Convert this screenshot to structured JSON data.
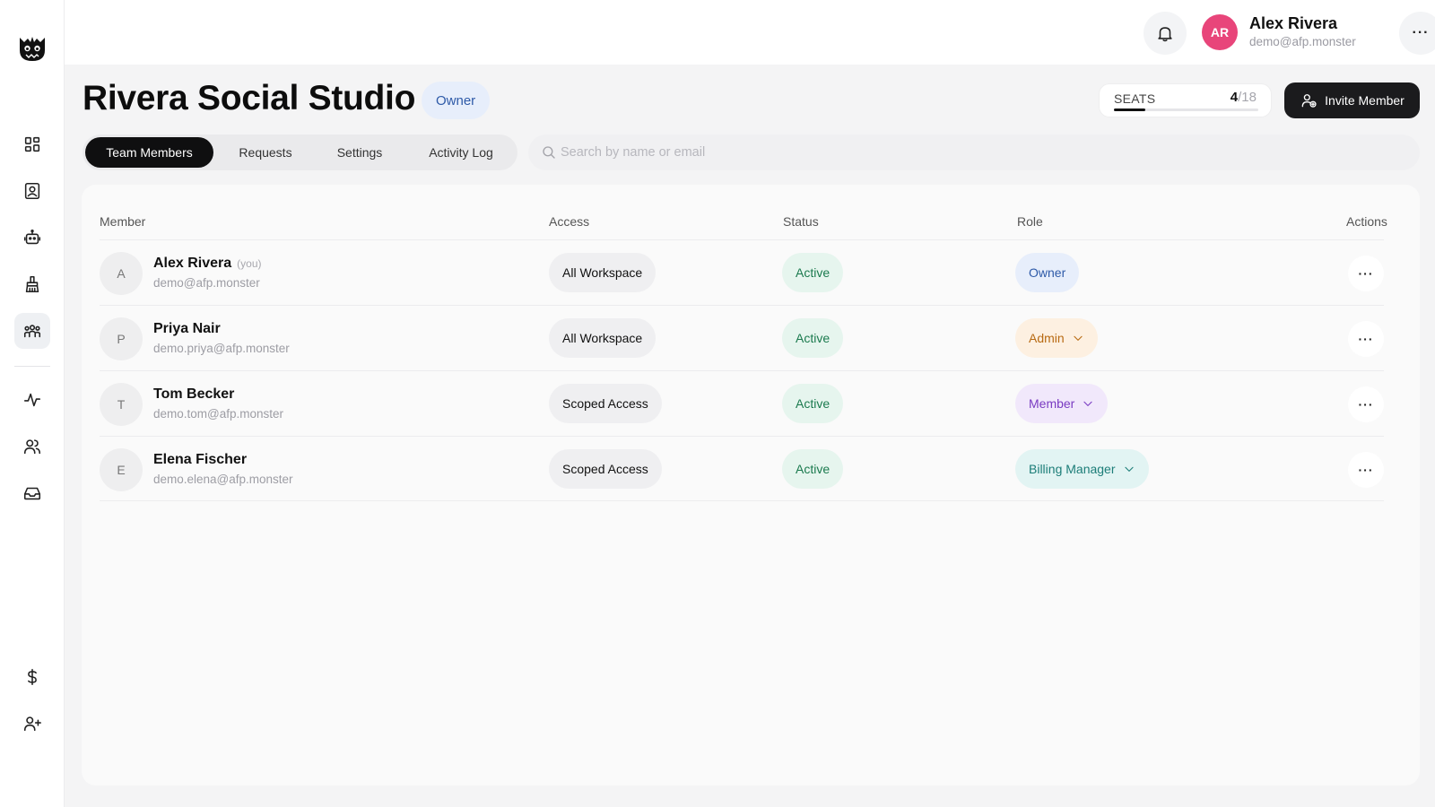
{
  "user": {
    "initials": "AR",
    "name": "Alex Rivera",
    "email": "demo@afp.monster",
    "avatar_color": "#e8457a"
  },
  "header": {
    "title": "Rivera Social Studio",
    "role_badge": "Owner"
  },
  "seats": {
    "label": "SEATS",
    "used": "4",
    "total_text": "/18",
    "used_fraction": 0.22
  },
  "invite_button": {
    "label": "Invite Member"
  },
  "tabs": [
    {
      "label": "Team Members",
      "active": true
    },
    {
      "label": "Requests",
      "active": false
    },
    {
      "label": "Settings",
      "active": false
    },
    {
      "label": "Activity Log",
      "active": false
    }
  ],
  "search": {
    "placeholder": "Search by name or email",
    "value": ""
  },
  "table": {
    "columns": {
      "member": "Member",
      "access": "Access",
      "status": "Status",
      "role": "Role",
      "actions": "Actions"
    },
    "rows": [
      {
        "initial": "A",
        "name": "Alex Rivera",
        "you_tag": "(you)",
        "email": "demo@afp.monster",
        "access": "All Workspace",
        "status": "Active",
        "role": "Owner",
        "role_editable": false
      },
      {
        "initial": "P",
        "name": "Priya Nair",
        "you_tag": "",
        "email": "demo.priya@afp.monster",
        "access": "All Workspace",
        "status": "Active",
        "role": "Admin",
        "role_editable": true
      },
      {
        "initial": "T",
        "name": "Tom Becker",
        "you_tag": "",
        "email": "demo.tom@afp.monster",
        "access": "Scoped Access",
        "status": "Active",
        "role": "Member",
        "role_editable": true
      },
      {
        "initial": "E",
        "name": "Elena Fischer",
        "you_tag": "",
        "email": "demo.elena@afp.monster",
        "access": "Scoped Access",
        "status": "Active",
        "role": "Billing Manager",
        "role_editable": true
      }
    ]
  },
  "sidebar": {
    "logo": "monster-logo-icon",
    "items": [
      {
        "icon": "dashboard-grid-icon",
        "active": false
      },
      {
        "icon": "contact-card-icon",
        "active": false
      },
      {
        "icon": "robot-icon",
        "active": false
      },
      {
        "icon": "cleaning-brush-icon",
        "active": false
      },
      {
        "icon": "team-group-icon",
        "active": true
      },
      {
        "icon": "activity-pulse-icon",
        "active": false
      },
      {
        "icon": "users-icon",
        "active": false
      },
      {
        "icon": "inbox-tray-icon",
        "active": false
      },
      {
        "icon": "dollar-icon",
        "active": false
      },
      {
        "icon": "add-user-icon",
        "active": false
      }
    ]
  }
}
